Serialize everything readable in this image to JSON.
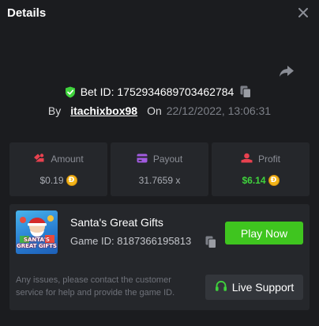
{
  "header": {
    "title": "Details",
    "close_icon": "close-icon"
  },
  "share_icon": "share-icon",
  "bet": {
    "label": "Bet ID:",
    "id": "1752934689703462784",
    "verified_icon": "shield-check-icon",
    "copy_icon": "copy-icon"
  },
  "by_line": {
    "by": "By",
    "username": "itachixbox98",
    "on": "On",
    "datetime": "22/12/2022, 13:06:31"
  },
  "stats": [
    {
      "icon": "amount-icon",
      "label": "Amount",
      "value": "$0.19",
      "coin": "Ð",
      "value_color": "#a9acb3"
    },
    {
      "icon": "wallet-icon",
      "label": "Payout",
      "value": "31.7659 x",
      "coin": null,
      "value_color": "#a9acb3"
    },
    {
      "icon": "profit-icon",
      "label": "Profit",
      "value": "$6.14",
      "coin": "Ð",
      "value_color": "#3fd23c"
    }
  ],
  "game": {
    "name": "Santa's Great Gifts",
    "thumb_text": "SANTA'S GREAT GIFTS",
    "id_label": "Game ID:",
    "id": "8187366195813",
    "play_label": "Play Now"
  },
  "support": {
    "note": "Any issues, please contact the customer service for help and provide the game ID.",
    "button_label": "Live Support",
    "icon": "headset-icon"
  },
  "colors": {
    "accent_green": "#3fc51f",
    "coin": "#f2b418",
    "icon_red": "#e8414f",
    "icon_purple": "#a25be0",
    "background": "#1b1c1f",
    "card": "#25272b"
  }
}
